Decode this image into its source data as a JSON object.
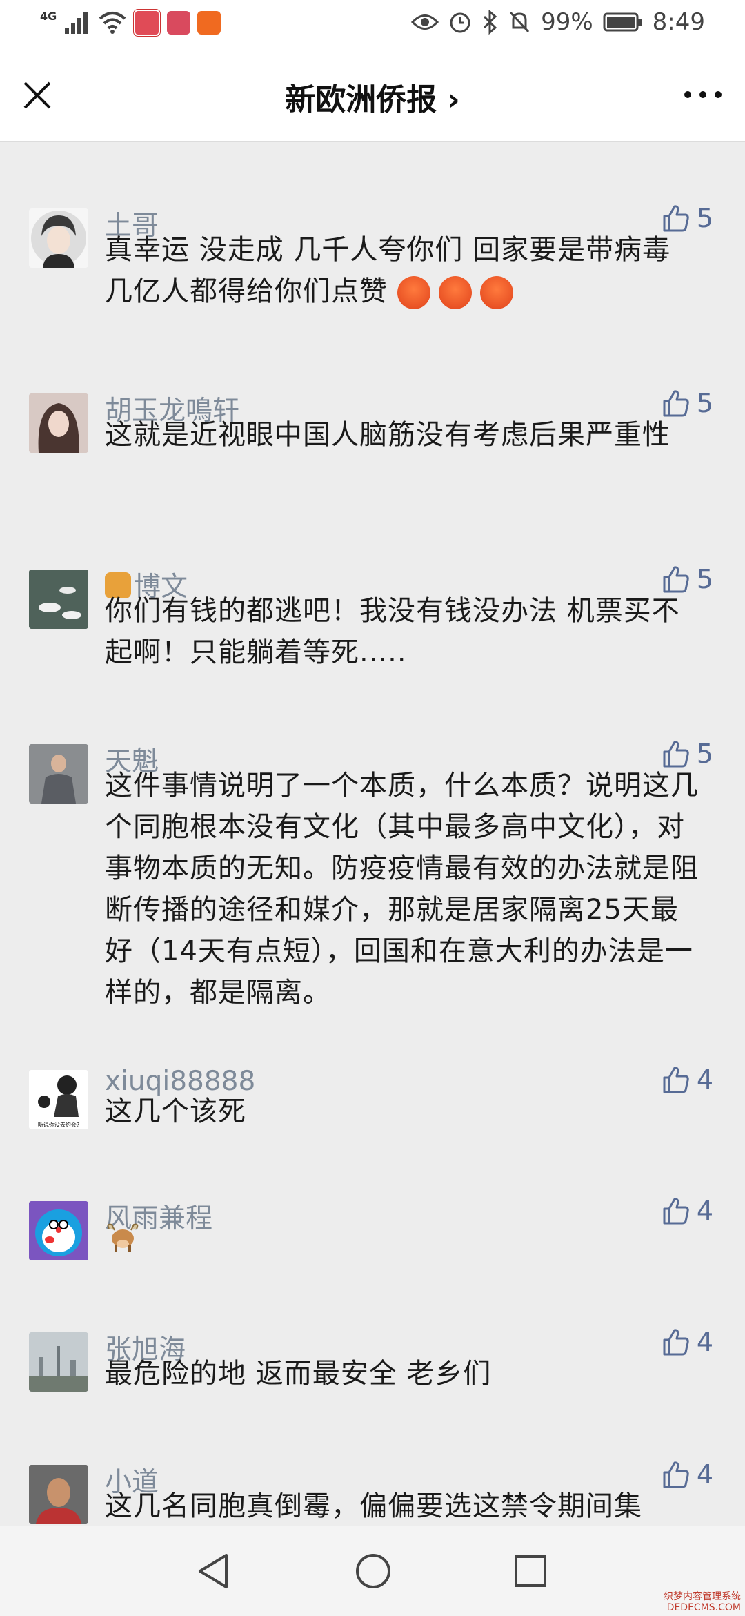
{
  "status_bar": {
    "network": "4G",
    "battery": "99%",
    "time": "8:49",
    "icons": [
      "signal-icon",
      "wifi-icon",
      "calendar-app-icon",
      "reader-app-icon",
      "video-app-icon",
      "eye-icon",
      "alarm-icon",
      "bluetooth-icon",
      "mute-icon",
      "battery-icon"
    ]
  },
  "header": {
    "title": "新欧洲侨报 ›",
    "close_icon": "close-icon",
    "more_icon": "more-icon"
  },
  "comments": [
    {
      "nick": "土哥",
      "likes": "5",
      "text": "真幸运 没走成 几千人夸你们  回家要是带病毒 几亿人都得给你们点赞",
      "emoji_count": 3,
      "avatar": "anime-boy"
    },
    {
      "nick": "胡玉龙鳴轩",
      "likes": "5",
      "text": "这就是近视眼中国人脑筋没有考虑后果严重性",
      "avatar": "woman"
    },
    {
      "nick": "博文",
      "nick_prefix_icon": "horse-icon",
      "likes": "5",
      "text": "你们有钱的都逃吧！我没有钱没办法 机票买不起啊！只能躺着等死.....",
      "avatar": "swans"
    },
    {
      "nick": "天魁",
      "likes": "5",
      "text": "这件事情说明了一个本质，什么本质？说明这几个同胞根本没有文化（其中最多高中文化），对事物本质的无知。防疫疫情最有效的办法就是阻断传播的途径和媒介，那就是居家隔离25天最好（14天有点短），回国和在意大利的办法是一样的，都是隔离。",
      "avatar": "man-suit"
    },
    {
      "nick": "xiuqi88888",
      "likes": "4",
      "text": "这几个该死",
      "avatar": "meme",
      "avatar_caption": "听说你没去约会?"
    },
    {
      "nick": "风雨兼程",
      "likes": "4",
      "text": "",
      "content_icon": "ox-icon",
      "avatar": "doraemon"
    },
    {
      "nick": "张旭海",
      "likes": "4",
      "text": "最危险的地  返而最安全  老乡们",
      "avatar": "city"
    },
    {
      "nick": "小道",
      "likes": "4",
      "text": "这几名同胞真倒霉，偏偏要选这禁令期间集",
      "avatar": "man-red"
    }
  ],
  "nav_bar": {
    "back_icon": "back-triangle-icon",
    "home_icon": "home-circle-icon",
    "recent_icon": "recent-square-icon"
  },
  "watermark": {
    "line1": "织梦内容管理系统",
    "line2": "DEDECMS.COM"
  },
  "colors": {
    "background": "#ededed",
    "nick": "#7e8a99",
    "like": "#576b95",
    "text": "#1a1a1a"
  }
}
